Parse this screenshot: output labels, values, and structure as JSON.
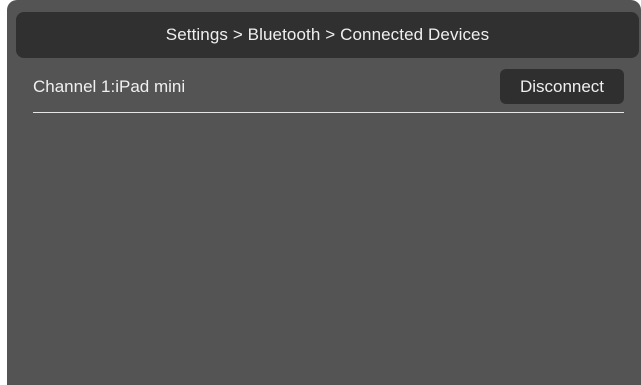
{
  "header": {
    "breadcrumb": "Settings > Bluetooth > Connected Devices"
  },
  "devices": [
    {
      "label": "Channel 1:iPad mini",
      "action_label": "Disconnect"
    }
  ]
}
